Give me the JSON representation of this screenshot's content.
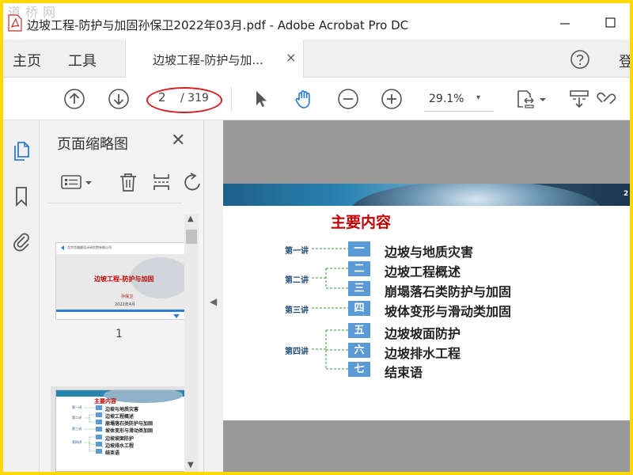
{
  "watermark": "道桥网",
  "window": {
    "title": "边坡工程-防护与加固孙保卫2022年03月.pdf - Adobe Acrobat Pro DC"
  },
  "tabs": {
    "home": "主页",
    "tools": "工具",
    "document": "边坡工程-防护与加...",
    "close": "×",
    "signin": "登"
  },
  "toolbar": {
    "page_current": "2",
    "page_total": "/ 319",
    "zoom": "29.1%",
    "zoom_caret": "▾"
  },
  "thumbnails": {
    "title": "页面缩略图",
    "close": "✕",
    "page1_number": "1",
    "page1": {
      "company": "北京华路顺设计研究院有限公司",
      "title": "边坡工程-防护与加固",
      "author": "孙保卫",
      "date": "2022年4月"
    },
    "page2": {
      "title": "主要内容",
      "items": [
        "边坡与地质灾害",
        "边坡工程概述",
        "崩塌落石类防护与加固",
        "坡体变形与滑动类加固",
        "边坡坡面防护",
        "边坡排水工程",
        "结束语"
      ],
      "lectures": [
        "第一讲",
        "第二讲",
        "第三讲",
        "第四讲"
      ]
    }
  },
  "slide": {
    "banner_number": "2",
    "title": "主要内容",
    "lectures": [
      "第一讲",
      "第二讲",
      "第三讲",
      "第四讲"
    ],
    "items": [
      {
        "num": "一",
        "text": "边坡与地质灾害"
      },
      {
        "num": "二",
        "text": "边坡工程概述"
      },
      {
        "num": "三",
        "text": "崩塌落石类防护与加固"
      },
      {
        "num": "四",
        "text": "坡体变形与滑动类加固"
      },
      {
        "num": "五",
        "text": "边坡坡面防护"
      },
      {
        "num": "六",
        "text": "边坡排水工程"
      },
      {
        "num": "七",
        "text": "结束语"
      }
    ]
  },
  "colors": {
    "accent_blue": "#2d7dd2",
    "annotation_red": "#d42020",
    "slide_title_red": "#c00000",
    "number_box_blue": "#5b9bd5",
    "border_yellow": "#ffd800"
  }
}
